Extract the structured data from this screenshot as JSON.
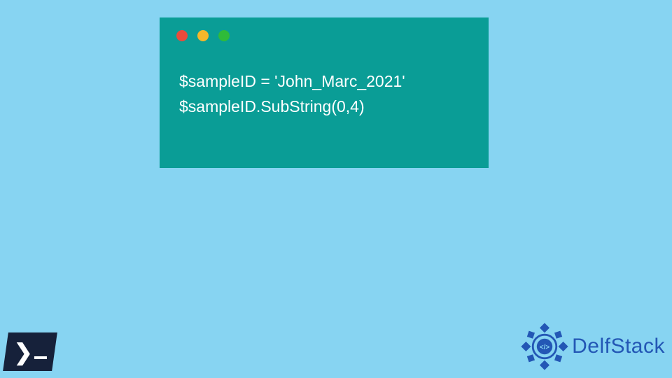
{
  "window": {
    "trafficLights": [
      "red",
      "yellow",
      "green"
    ]
  },
  "code": {
    "line1": "$sampleID = 'John_Marc_2021'",
    "line2": "$sampleID.SubString(0,4)"
  },
  "logos": {
    "powershellAlt": "PowerShell",
    "delfStackText": "DelfStack"
  }
}
